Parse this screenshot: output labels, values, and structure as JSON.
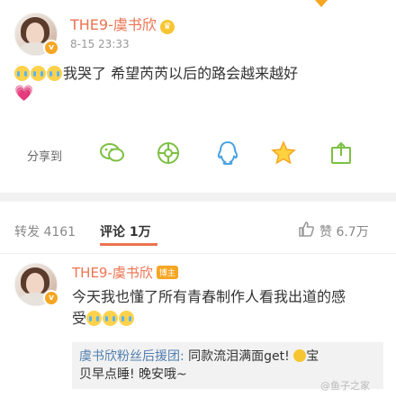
{
  "post": {
    "username": "THE9-虞书欣",
    "time": "8-15 23:33",
    "text": "我哭了 希望芮芮以后的路会越来越好",
    "share_label": "分享到"
  },
  "share_icons": [
    "wechat-icon",
    "moments-icon",
    "qq-icon",
    "favorite-star-icon",
    "more-share-icon"
  ],
  "tabs": {
    "repost": "转发 4161",
    "comments": "评论 1万",
    "likes": "赞 6.7万"
  },
  "comment": {
    "username": "THE9-虞书欣",
    "badge": "博主",
    "text_line1": "今天我也懂了所有青春制作人看我出道的感",
    "text_line2": "受",
    "reply_user": "虞书欣粉丝后援团:",
    "reply_text1": " 同款流泪满面get! ",
    "reply_text2": "贝早点睡! 晚安哦~",
    "reply_tail": "宝"
  },
  "watermark": "@鱼子之家",
  "colors": {
    "accent": "#eb7350",
    "star": "#f5a623",
    "link": "#507daf"
  }
}
